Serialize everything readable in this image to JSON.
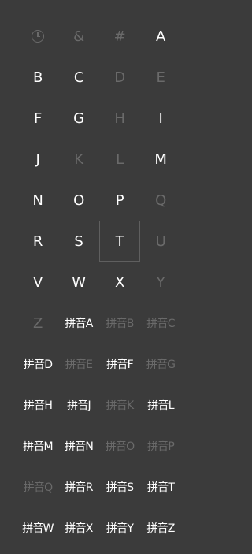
{
  "jump_list": {
    "items": [
      {
        "label": "",
        "icon": "clock-icon",
        "enabled": false
      },
      {
        "label": "&",
        "enabled": false
      },
      {
        "label": "#",
        "enabled": false
      },
      {
        "label": "A",
        "enabled": true
      },
      {
        "label": "B",
        "enabled": true
      },
      {
        "label": "C",
        "enabled": true
      },
      {
        "label": "D",
        "enabled": false
      },
      {
        "label": "E",
        "enabled": false
      },
      {
        "label": "F",
        "enabled": true
      },
      {
        "label": "G",
        "enabled": true
      },
      {
        "label": "H",
        "enabled": false
      },
      {
        "label": "I",
        "enabled": true
      },
      {
        "label": "J",
        "enabled": true
      },
      {
        "label": "K",
        "enabled": false
      },
      {
        "label": "L",
        "enabled": false
      },
      {
        "label": "M",
        "enabled": true
      },
      {
        "label": "N",
        "enabled": true
      },
      {
        "label": "O",
        "enabled": true
      },
      {
        "label": "P",
        "enabled": true
      },
      {
        "label": "Q",
        "enabled": false
      },
      {
        "label": "R",
        "enabled": true
      },
      {
        "label": "S",
        "enabled": true
      },
      {
        "label": "T",
        "enabled": true,
        "selected": true
      },
      {
        "label": "U",
        "enabled": false
      },
      {
        "label": "V",
        "enabled": true
      },
      {
        "label": "W",
        "enabled": true
      },
      {
        "label": "X",
        "enabled": true
      },
      {
        "label": "Y",
        "enabled": false
      },
      {
        "label": "Z",
        "enabled": false
      },
      {
        "label": "拼音A",
        "enabled": true
      },
      {
        "label": "拼音B",
        "enabled": false
      },
      {
        "label": "拼音C",
        "enabled": false
      },
      {
        "label": "拼音D",
        "enabled": true
      },
      {
        "label": "拼音E",
        "enabled": false
      },
      {
        "label": "拼音F",
        "enabled": true
      },
      {
        "label": "拼音G",
        "enabled": false
      },
      {
        "label": "拼音H",
        "enabled": true
      },
      {
        "label": "拼音J",
        "enabled": true
      },
      {
        "label": "拼音K",
        "enabled": false
      },
      {
        "label": "拼音L",
        "enabled": true
      },
      {
        "label": "拼音M",
        "enabled": true
      },
      {
        "label": "拼音N",
        "enabled": true
      },
      {
        "label": "拼音O",
        "enabled": false
      },
      {
        "label": "拼音P",
        "enabled": false
      },
      {
        "label": "拼音Q",
        "enabled": false
      },
      {
        "label": "拼音R",
        "enabled": true
      },
      {
        "label": "拼音S",
        "enabled": true
      },
      {
        "label": "拼音T",
        "enabled": true
      },
      {
        "label": "拼音W",
        "enabled": true
      },
      {
        "label": "拼音X",
        "enabled": true
      },
      {
        "label": "拼音Y",
        "enabled": true
      },
      {
        "label": "拼音Z",
        "enabled": true
      }
    ],
    "colors": {
      "background": "#3b3b3b",
      "enabled_text": "#ffffff",
      "disabled_text": "#6a6a6a",
      "selection_border": "#5f5f5f"
    }
  }
}
